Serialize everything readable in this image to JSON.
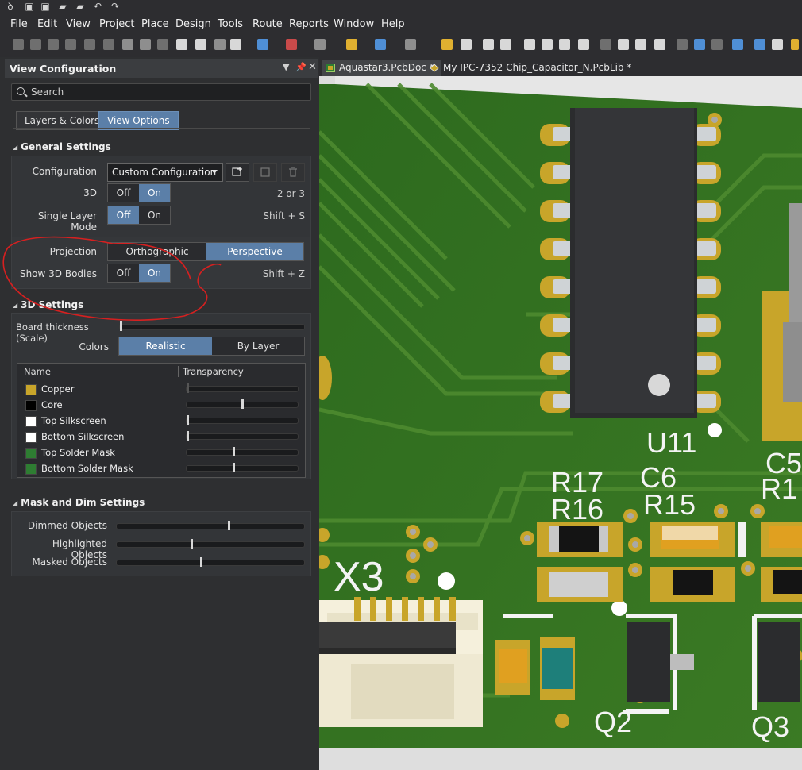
{
  "menu": [
    "File",
    "Edit",
    "View",
    "Project",
    "Place",
    "Design",
    "Tools",
    "Route",
    "Reports",
    "Window",
    "Help"
  ],
  "panel": {
    "title": "View Configuration",
    "search_placeholder": "Search",
    "tabs": [
      "Layers & Colors",
      "View Options"
    ],
    "general": {
      "heading": "General Settings",
      "configuration_label": "Configuration",
      "configuration_value": "Custom Configuration",
      "threed_label": "3D",
      "threed_hint": "2 or 3",
      "single_layer_label": "Single Layer Mode",
      "single_layer_hint": "Shift + S",
      "projection_label": "Projection",
      "projection_options": [
        "Orthographic",
        "Perspective"
      ],
      "show3d_label": "Show 3D Bodies",
      "show3d_hint": "Shift + Z",
      "off": "Off",
      "on": "On"
    },
    "threed_settings": {
      "heading": "3D Settings",
      "board_thickness_label": "Board thickness (Scale)",
      "board_thickness_value": 0.0,
      "colors_label": "Colors",
      "colors_options": [
        "Realistic",
        "By Layer"
      ],
      "table_headers": [
        "Name",
        "Transparency"
      ],
      "rows": [
        {
          "name": "Copper",
          "color": "#c8a52a",
          "transparency": 0.0
        },
        {
          "name": "Core",
          "color": "#000000",
          "transparency": 0.5
        },
        {
          "name": "Top Silkscreen",
          "color": "#ffffff",
          "transparency": 0.0
        },
        {
          "name": "Bottom Silkscreen",
          "color": "#ffffff",
          "transparency": 0.0
        },
        {
          "name": "Top Solder Mask",
          "color": "#2e7d32",
          "transparency": 0.42
        },
        {
          "name": "Bottom Solder Mask",
          "color": "#2e7d32",
          "transparency": 0.42
        }
      ]
    },
    "mask": {
      "heading": "Mask and Dim Settings",
      "rows": [
        {
          "label": "Dimmed Objects",
          "value": 0.6
        },
        {
          "label": "Highlighted Objects",
          "value": 0.4
        },
        {
          "label": "Masked Objects",
          "value": 0.45
        }
      ]
    }
  },
  "doc_tabs": [
    "Aquastar3.PcbDoc *",
    "My IPC-7352 Chip_Capacitor_N.PcbLib *"
  ],
  "pcb_labels": {
    "u11": "U11",
    "r17": "R17",
    "r16": "R16",
    "c6": "C6",
    "r15": "R15",
    "c5": "C5",
    "r1": "R1",
    "x3": "X3",
    "q2": "Q2",
    "q3": "Q3"
  },
  "colors": {
    "accent": "#5b7fa8",
    "annotation": "#d62020",
    "pcb_green": "#2f6b1f",
    "copper": "#c8a52a"
  }
}
